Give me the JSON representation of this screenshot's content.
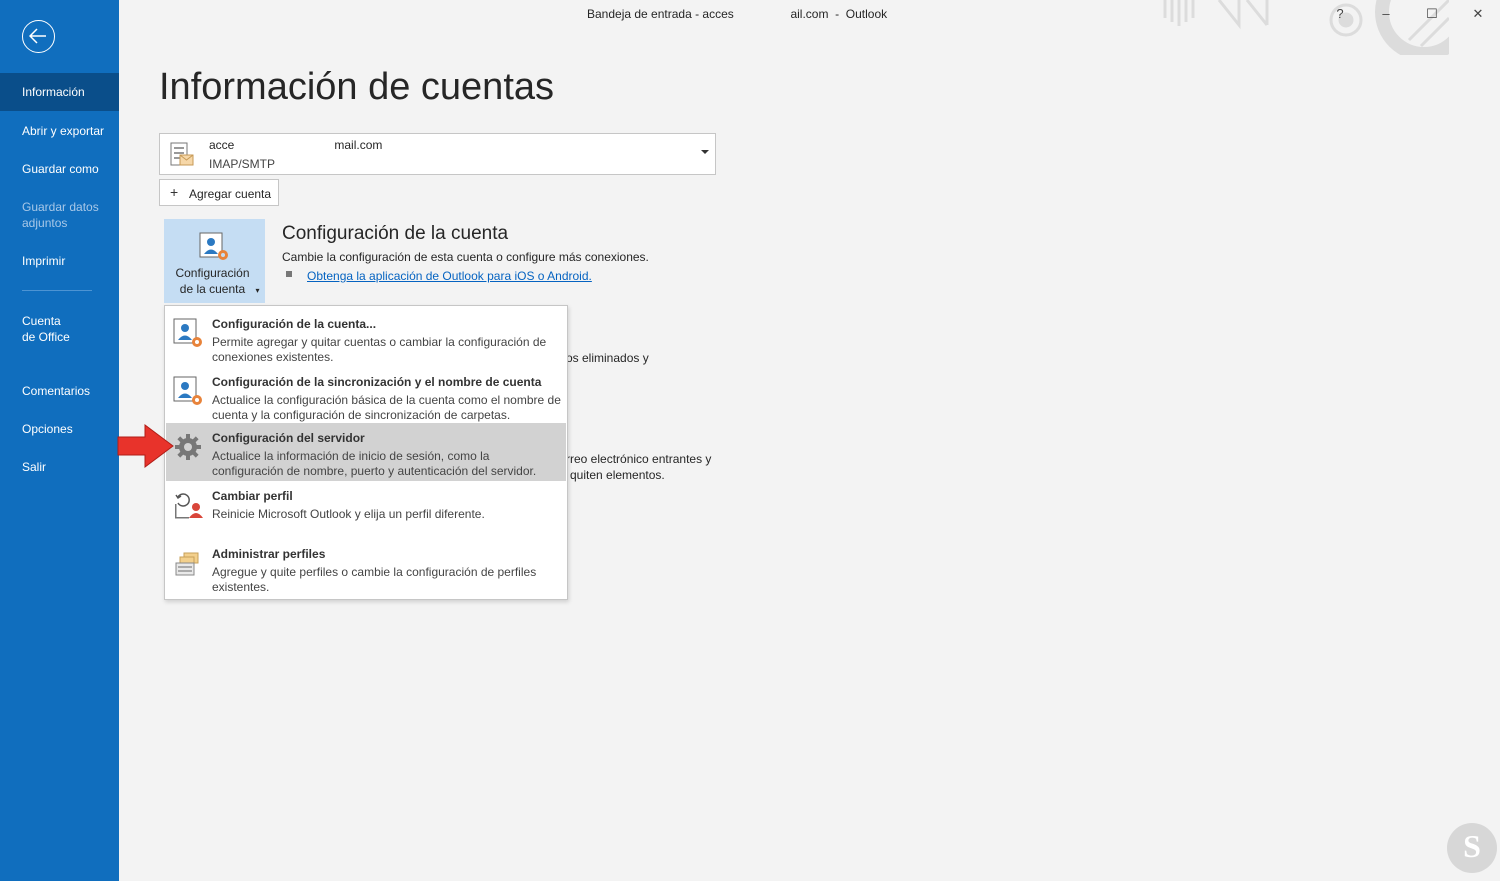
{
  "window": {
    "title": "Bandeja de entrada - acces                 ail.com  -  Outlook",
    "help": "?",
    "minimize": "–",
    "maximize": "☐",
    "close": "✕"
  },
  "sidebar": {
    "items": [
      {
        "label": "Información",
        "active": true
      },
      {
        "label": "Abrir y exportar"
      },
      {
        "label": "Guardar como"
      },
      {
        "label": "Guardar datos adjuntos",
        "disabled": true
      },
      {
        "label": "Imprimir"
      },
      {
        "label": "Cuenta de Office"
      },
      {
        "label": "Comentarios"
      },
      {
        "label": "Opciones"
      },
      {
        "label": "Salir"
      }
    ],
    "accent": "#106ebe"
  },
  "main": {
    "title": "Información de cuentas",
    "account": {
      "email": "acce                              mail.com",
      "type": "IMAP/SMTP"
    },
    "add_account_label": "Agregar cuenta",
    "account_settings_button": "Configuración de la cuenta",
    "section": {
      "title": "Configuración de la cuenta",
      "desc": "Cambie la configuración de esta cuenta o configure más conexiones.",
      "link": "Obtenga la aplicación de Outlook para iOS o Android."
    },
    "behind": {
      "line1": "os eliminados y",
      "line2": "rreo electrónico entrantes y",
      "line3": "quiten elementos."
    }
  },
  "menu": {
    "items": [
      {
        "title": "Configuración de la cuenta...",
        "desc": "Permite agregar y quitar cuentas o cambiar la configuración de conexiones existentes.",
        "icon": "account-settings-icon"
      },
      {
        "title": "Configuración de la sincronización y el nombre de cuenta",
        "desc": "Actualice la configuración básica de la cuenta como el nombre de cuenta y la configuración de sincronización de carpetas.",
        "icon": "sync-settings-icon"
      },
      {
        "title": "Configuración del servidor",
        "desc": "Actualice la información de inicio de sesión, como la configuración de nombre, puerto y autenticación del servidor.",
        "icon": "gear-icon",
        "highlighted": true
      },
      {
        "title": "Cambiar perfil",
        "desc": "Reinicie Microsoft Outlook y elija un perfil diferente.",
        "icon": "change-profile-icon"
      },
      {
        "title": "Administrar perfiles",
        "desc": "Agregue y quite perfiles o cambie la configuración de perfiles existentes.",
        "icon": "manage-profiles-icon"
      }
    ]
  },
  "watermark": {
    "letter": "S"
  }
}
